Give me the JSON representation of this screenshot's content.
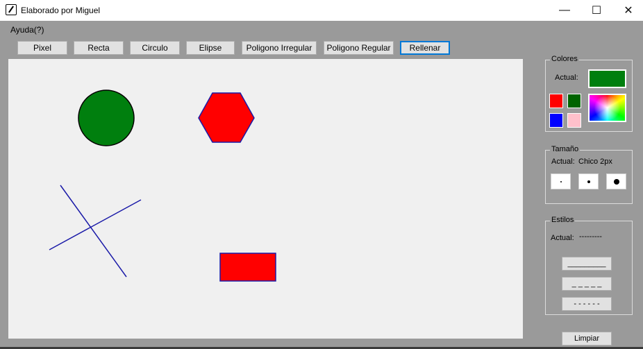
{
  "window": {
    "title": "Elaborado por Miguel",
    "minimize_glyph": "—",
    "maximize_glyph": "☐",
    "close_glyph": "✕"
  },
  "menu": {
    "help": "Ayuda(?)"
  },
  "toolbar": {
    "pixel": "Pixel",
    "recta": "Recta",
    "circulo": "Circulo",
    "elipse": "Elipse",
    "poligono_irregular": "Poligono Irregular",
    "poligono_regular": "Poligono Regular",
    "rellenar": "Rellenar"
  },
  "colores": {
    "title": "Colores",
    "actual_label": "Actual:",
    "actual_color": "#007f0e",
    "swatches": [
      "#ff0000",
      "#006400",
      "#0000ff",
      "#ffc0cb"
    ]
  },
  "tamano": {
    "title": "Tamaño",
    "actual_label": "Actual:",
    "actual_value": "Chico 2px"
  },
  "estilos": {
    "title": "Estilos",
    "actual_label": "Actual:",
    "actual_value": "---------",
    "solid": "_________",
    "dashed": "_ _ _ _ _",
    "dotted": "- - - - - -"
  },
  "limpiar": "Limpiar",
  "colors": {
    "circle_fill": "#007f0e",
    "shape_fill": "#ff0000",
    "outline": "#1a1aa8"
  }
}
